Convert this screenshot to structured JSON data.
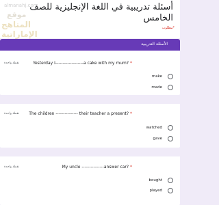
{
  "header": {
    "title": "أسئلة تدريبية في اللغة الإنجليزية للصف الخامس",
    "required_note": "*مطلوب",
    "watermark": {
      "url": "almanahj.com",
      "logo_line1": "موقع",
      "logo_line2": "المناهج الإماراتية"
    }
  },
  "section": {
    "title": "الأسئلة التدريبية"
  },
  "questions": [
    {
      "points": "نقطة واحدة",
      "text": "Yesterday I-------------------a cake with my mum?",
      "required_mark": "*",
      "options": [
        "make",
        "made"
      ]
    },
    {
      "points": "نقطة واحدة",
      "text": "The children --------------- their teacher a present?",
      "required_mark": "*",
      "options": [
        "watched",
        "gave"
      ]
    },
    {
      "points": "نقطة واحدة",
      "text": "My uncle ---------------answer car?",
      "required_mark": "*",
      "options": [
        "bought",
        "played"
      ]
    }
  ],
  "colors": {
    "accent": "#673ab7",
    "background": "#f0ebf8",
    "required": "#d93025"
  }
}
